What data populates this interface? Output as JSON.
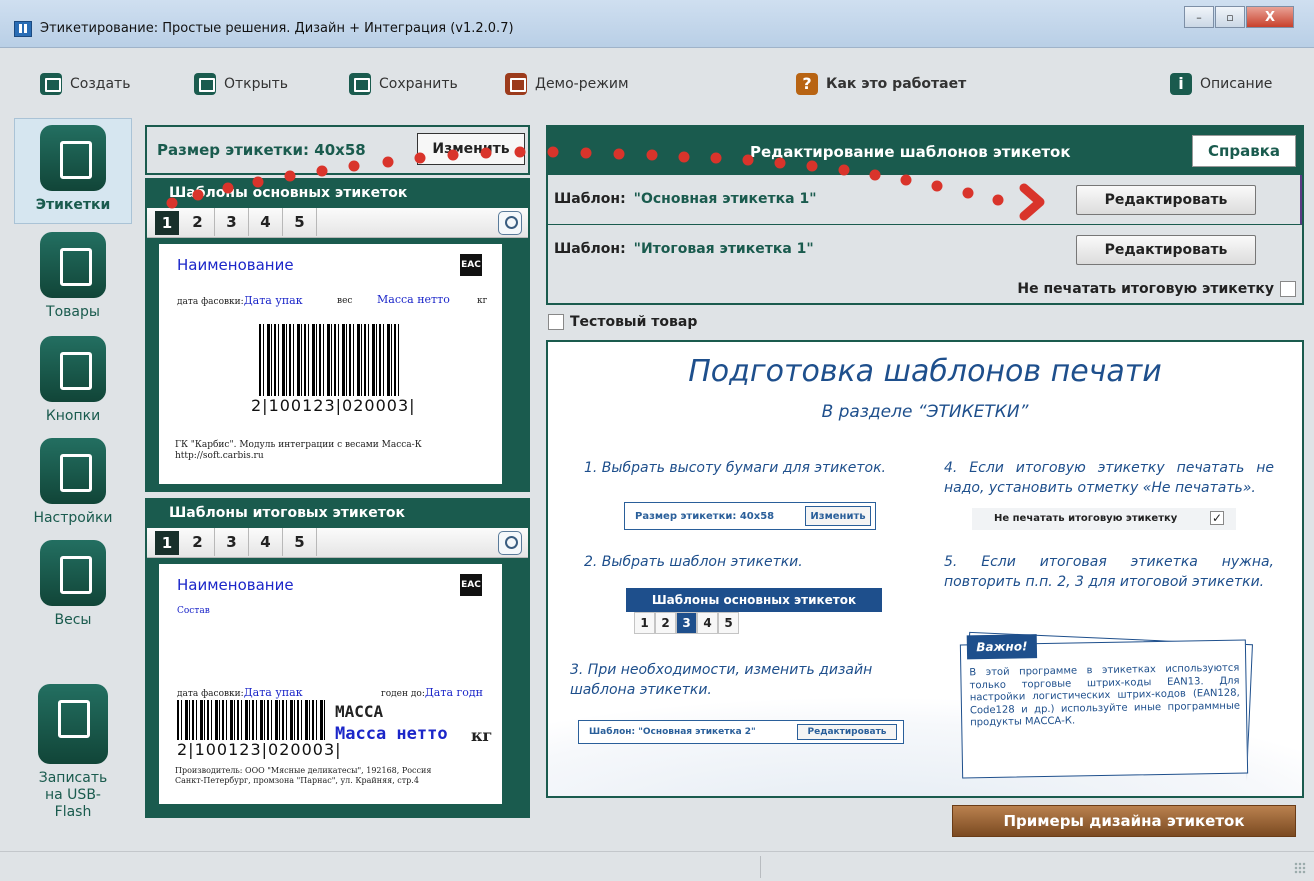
{
  "window": {
    "title": "Этикетирование: Простые решения. Дизайн + Интеграция (v1.2.0.7)",
    "minimize": "–",
    "maximize": "▫",
    "close": "X"
  },
  "toolbar": {
    "create": "Создать",
    "open": "Открыть",
    "save": "Сохранить",
    "demo": "Демо-режим",
    "how_it_works": "Как это работает",
    "description": "Описание",
    "help_glyph": "?",
    "info_glyph": "i"
  },
  "nav": {
    "labels": "Этикетки",
    "goods": "Товары",
    "buttons": "Кнопки",
    "settings": "Настройки",
    "scales": "Весы",
    "usb": "Записать на USB-Flash"
  },
  "size_panel": {
    "label": "Размер этикетки:  40x58",
    "change": "Изменить"
  },
  "main_templates": {
    "title": "Шаблоны основных этикеток",
    "tabs": [
      "1",
      "2",
      "3",
      "4",
      "5"
    ],
    "active_tab": "1",
    "preview": {
      "name": "Наименование",
      "eac": "EAC",
      "pack_date_label": "дата фасовки:",
      "pack_date": "Дата упак",
      "weight_label": "вес",
      "net_weight": "Масса нетто",
      "unit": "кг",
      "barcode_digits": "2|100123|020003|",
      "footer_line1": "ГК \"Карбис\". Модуль интеграции с весами Масса-К",
      "footer_line2": "http://soft.carbis.ru"
    }
  },
  "total_templates": {
    "title": "Шаблоны итоговых этикеток",
    "tabs": [
      "1",
      "2",
      "3",
      "4",
      "5"
    ],
    "active_tab": "1",
    "preview": {
      "name": "Наименование",
      "eac": "EAC",
      "composition": "Состав",
      "pack_date_label": "дата фасовки:",
      "pack_date": "Дата упак",
      "valid_label": "годен до:",
      "valid_date": "Дата годн",
      "massa": "МАССА",
      "net_weight": "Масса нетто",
      "unit": "кг",
      "barcode_digits": "2|100123|020003|",
      "producer_line1": "Производитель: ООО \"Мясные деликатесы\", 192168, Россия",
      "producer_line2": "Санкт-Петербург, промзона \"Парнас\", ул. Крайняя, стр.4"
    }
  },
  "editor": {
    "title": "Редактирование шаблонов этикеток",
    "help": "Справка",
    "template_label": "Шаблон:",
    "main_template": "\"Основная этикетка 1\"",
    "total_template": "\"Итоговая этикетка 1\"",
    "edit": "Редактировать",
    "no_print_total": "Не печатать итоговую этикетку"
  },
  "test_item": "Тестовый товар",
  "info": {
    "title": "Подготовка шаблонов печати",
    "subtitle": "В разделе “ЭТИКЕТКИ”",
    "step1": "1. Выбрать высоту бумаги для этикеток.",
    "step1_box_label": "Размер этикетки: 40x58",
    "step1_box_btn": "Изменить",
    "step2": "2. Выбрать шаблон этикетки.",
    "step2_head": "Шаблоны основных этикеток",
    "step2_tabs": [
      "1",
      "2",
      "3",
      "4",
      "5"
    ],
    "step3": "3. При необходимости, изменить дизайн шаблона этикетки.",
    "step3_box_label": "Шаблон: \"Основная этикетка 2\"",
    "step3_box_btn": "Редактировать",
    "step4": "4. Если итоговую этикетку печатать не надо, установить отметку «Не печатать».",
    "step4_box_label": "Не печатать итоговую этикетку",
    "step5": "5. Если итоговая этикетка нужна, повторить п.п. 2, 3 для итоговой этикетки.",
    "important_head": "Важно!",
    "important_text": "В этой программе в этикетках используются только торговые штрих-коды EAN13. Для настройки логистических штрих-кодов (EAN128, Code128 и др.) используйте иные программные продукты МАССА-К."
  },
  "examples_button": "Примеры дизайна этикеток",
  "colors": {
    "accent": "#1a5b4e",
    "info_blue": "#1e4f8c",
    "marker_red": "#d9342b",
    "examples_brown": "#8c5529"
  }
}
